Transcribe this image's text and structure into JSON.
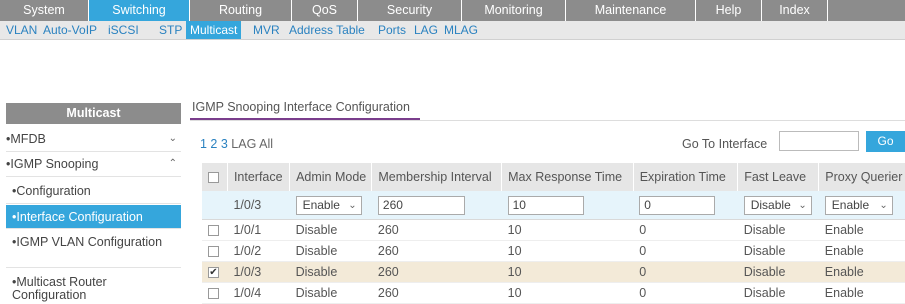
{
  "topnav": [
    "System",
    "Switching",
    "Routing",
    "QoS",
    "Security",
    "Monitoring",
    "Maintenance",
    "Help",
    "Index"
  ],
  "subnav": [
    "VLAN",
    "Auto-VoIP",
    "iSCSI",
    "STP",
    "Multicast",
    "MVR",
    "Address Table",
    "Ports",
    "LAG",
    "MLAG"
  ],
  "sidebar": {
    "title": "Multicast",
    "items": {
      "mfdb": "MFDB",
      "igmp_snooping": "IGMP Snooping",
      "configuration": "Configuration",
      "interface_configuration": "Interface Configuration",
      "igmp_vlan_configuration": "IGMP VLAN Configuration",
      "multicast_router_configuration": "Multicast Router Configuration"
    }
  },
  "panel": {
    "title": "IGMP Snooping Interface Configuration"
  },
  "pagination": {
    "pages": "1 2 3",
    "lag": "LAG",
    "all": "All"
  },
  "goto": {
    "label": "Go To Interface",
    "value": "",
    "button": "Go"
  },
  "table": {
    "headers": {
      "interface": "Interface",
      "admin_mode": "Admin Mode",
      "membership_interval": "Membership Interval",
      "max_response_time": "Max Response Time",
      "expiration_time": "Expiration Time",
      "fast_leave": "Fast Leave",
      "proxy_querier": "Proxy Querier"
    },
    "edit_row": {
      "interface": "1/0/3",
      "admin_mode": "Enable",
      "membership_interval": "260",
      "max_response_time": "10",
      "expiration_time": "0",
      "fast_leave": "Disable",
      "proxy_querier": "Enable"
    },
    "rows": [
      {
        "interface": "1/0/1",
        "admin_mode": "Disable",
        "membership_interval": "260",
        "max_response_time": "10",
        "expiration_time": "0",
        "fast_leave": "Disable",
        "proxy_querier": "Enable"
      },
      {
        "interface": "1/0/2",
        "admin_mode": "Disable",
        "membership_interval": "260",
        "max_response_time": "10",
        "expiration_time": "0",
        "fast_leave": "Disable",
        "proxy_querier": "Enable"
      },
      {
        "interface": "1/0/3",
        "admin_mode": "Disable",
        "membership_interval": "260",
        "max_response_time": "10",
        "expiration_time": "0",
        "fast_leave": "Disable",
        "proxy_querier": "Enable"
      },
      {
        "interface": "1/0/4",
        "admin_mode": "Disable",
        "membership_interval": "260",
        "max_response_time": "10",
        "expiration_time": "0",
        "fast_leave": "Disable",
        "proxy_querier": "Enable"
      }
    ]
  },
  "colors": {
    "accent": "#35a6dc",
    "nav_gray": "#8c8c8c",
    "tab_underline": "#7a3d8c",
    "selected_row": "#f3ead8"
  }
}
